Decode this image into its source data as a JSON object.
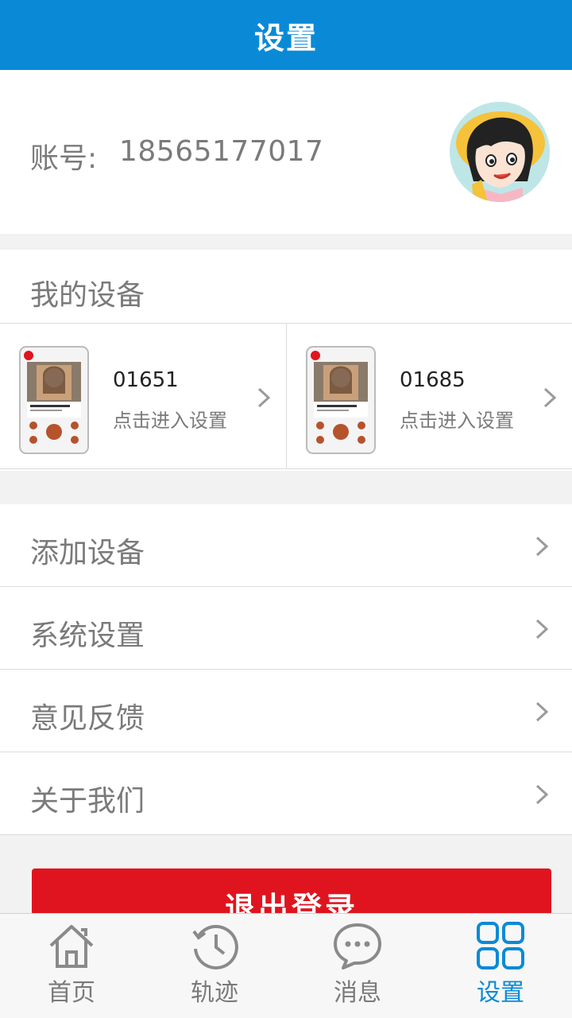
{
  "header": {
    "title": "设置"
  },
  "account": {
    "label": "账号:",
    "number": "18565177017"
  },
  "my_devices": {
    "title": "我的设备",
    "items": [
      {
        "id": "01651",
        "action": "点击进入设置"
      },
      {
        "id": "01685",
        "action": "点击进入设置"
      }
    ]
  },
  "menu": {
    "items": [
      {
        "label": "添加设备"
      },
      {
        "label": "系统设置"
      },
      {
        "label": "意见反馈"
      },
      {
        "label": "关于我们"
      }
    ]
  },
  "logout": {
    "label": "退出登录"
  },
  "tabs": [
    {
      "label": "首页",
      "icon": "home-icon"
    },
    {
      "label": "轨迹",
      "icon": "history-clock-icon"
    },
    {
      "label": "消息",
      "icon": "chat-bubble-icon"
    },
    {
      "label": "设置",
      "icon": "grid-settings-icon",
      "active": true
    }
  ],
  "colors": {
    "primary": "#0a8ad6",
    "logout": "#e0141e",
    "text": "#7a7a7a"
  }
}
